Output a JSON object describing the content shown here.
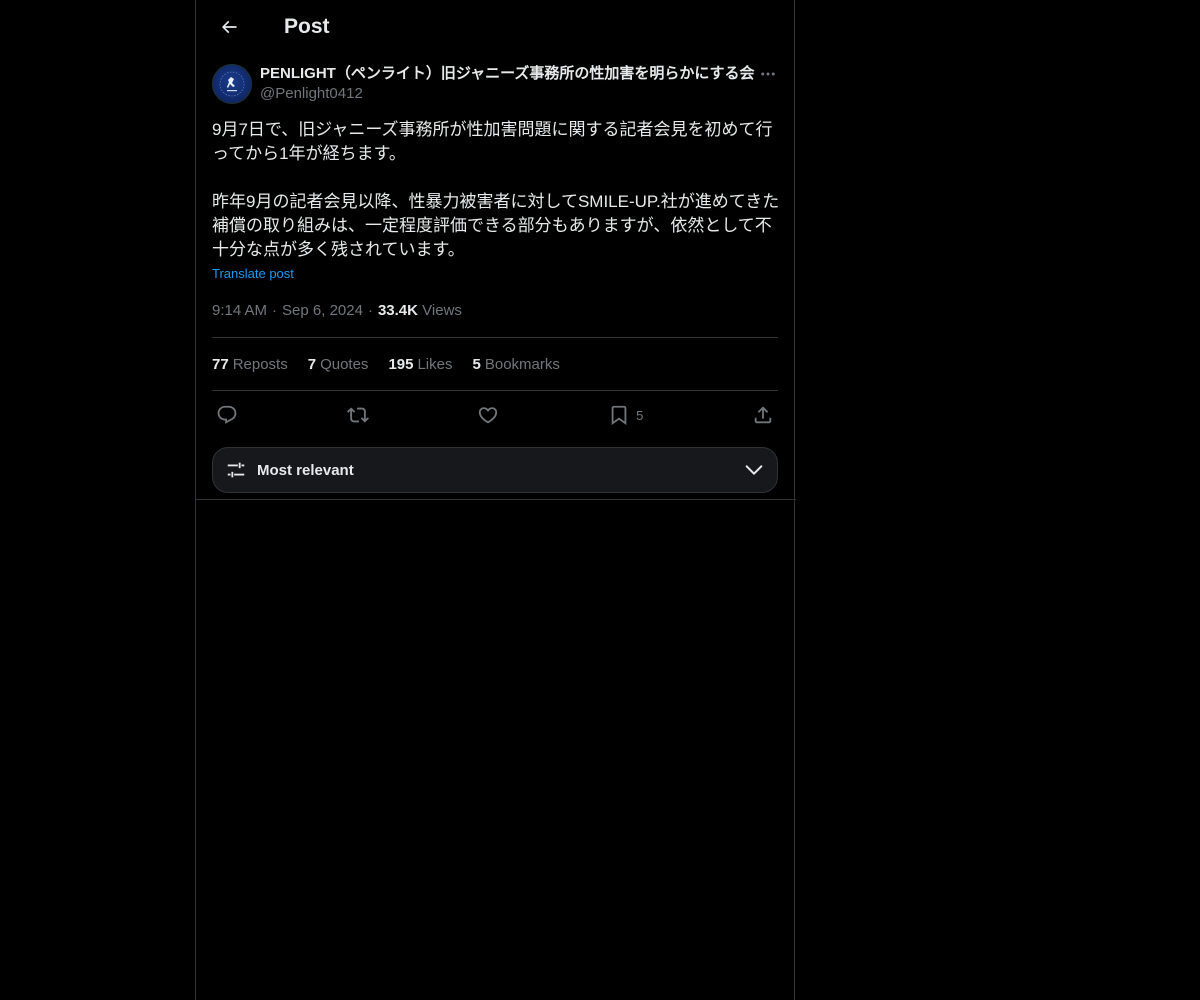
{
  "header": {
    "title": "Post"
  },
  "post": {
    "author_name": "PENLIGHT（ペンライト）旧ジャニーズ事務所の性加害を明らかにする会",
    "author_handle": "@Penlight0412",
    "body": "9月7日で、旧ジャニーズ事務所が性加害問題に関する記者会見を初めて行ってから1年が経ちます。\n\n昨年9月の記者会見以降、性暴力被害者に対してSMILE-UP.社が進めてきた補償の取り組みは、一定程度評価できる部分もありますが、依然として不十分な点が多く残されています。",
    "translate_label": "Translate post",
    "time": "9:14 AM",
    "date": "Sep 6, 2024",
    "views_count": "33.4K",
    "views_label": "Views"
  },
  "stats": [
    {
      "num": "77",
      "label": "Reposts"
    },
    {
      "num": "7",
      "label": "Quotes"
    },
    {
      "num": "195",
      "label": "Likes"
    },
    {
      "num": "5",
      "label": "Bookmarks"
    }
  ],
  "actions": {
    "reply_icon": "reply-icon",
    "repost_icon": "repost-icon",
    "like_icon": "heart-icon",
    "bookmark_icon": "bookmark-icon",
    "bookmark_count": "5",
    "share_icon": "share-icon"
  },
  "sort": {
    "label": "Most relevant"
  },
  "colors": {
    "accent": "#1d9bf0",
    "muted": "#71767b",
    "text": "#e7e9ea",
    "border": "#2f3336",
    "background": "#000000"
  }
}
